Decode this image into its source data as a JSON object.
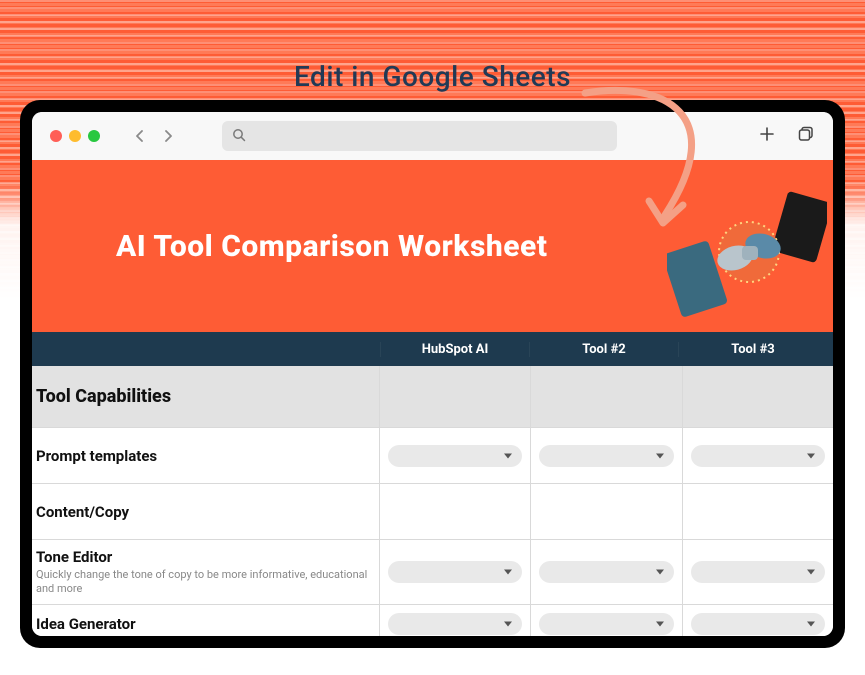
{
  "callout_text": "Edit in Google Sheets",
  "hero_title": "AI Tool Comparison Worksheet",
  "columns": [
    "HubSpot AI",
    "Tool #2",
    "Tool #3"
  ],
  "rows": [
    {
      "type": "section",
      "title": "Tool Capabilities"
    },
    {
      "type": "feature",
      "title": "Prompt templates",
      "desc": "",
      "has_dropdowns": true
    },
    {
      "type": "section-sub",
      "title": "Content/Copy"
    },
    {
      "type": "feature",
      "title": "Tone Editor",
      "desc": "Quickly change the tone of copy to be more informative, educational and more",
      "has_dropdowns": true
    },
    {
      "type": "feature",
      "title": "Idea Generator",
      "desc": "",
      "has_dropdowns": true
    }
  ]
}
